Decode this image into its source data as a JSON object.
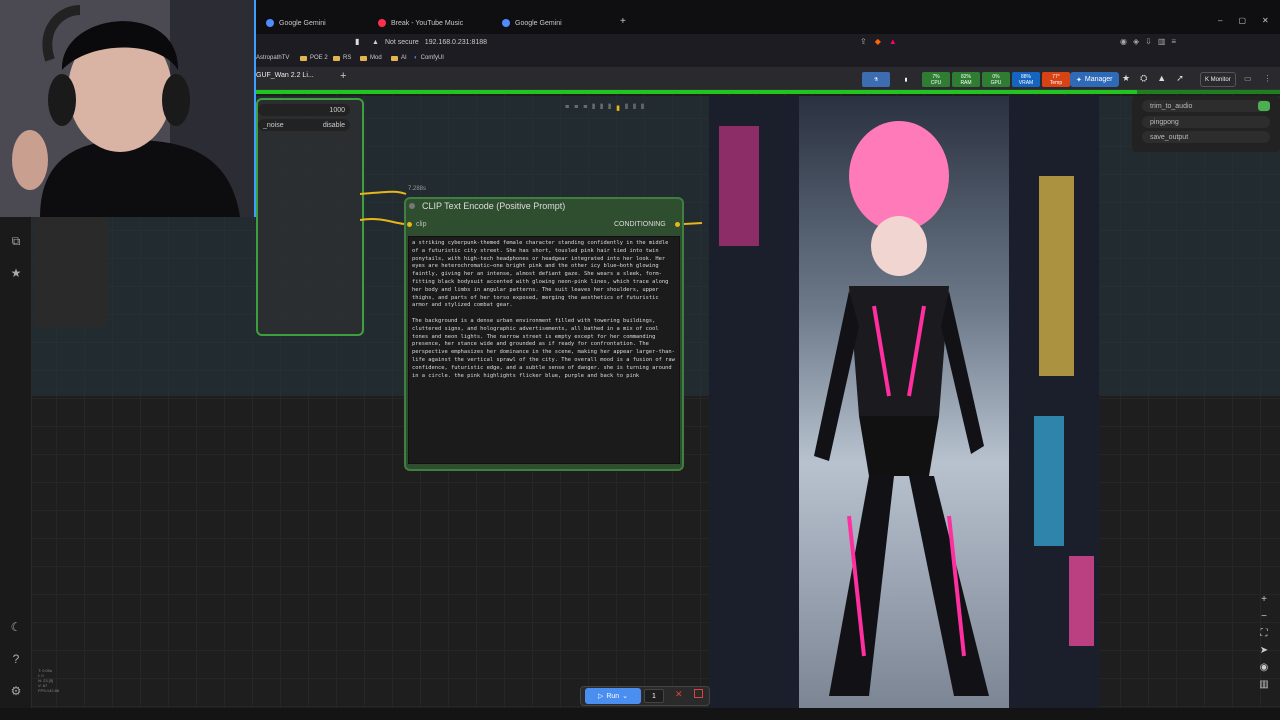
{
  "browser": {
    "tabs": [
      {
        "label": "Google Gemini",
        "color": "#4f8cff"
      },
      {
        "label": "Break - YouTube Music",
        "color": "#ff2e4c"
      },
      {
        "label": "Google Gemini",
        "color": "#4f8cff"
      }
    ],
    "new_tab": "+",
    "security": "Not secure",
    "url": "192.168.0.231:8188",
    "bookmarks": [
      "AstropathTV",
      "POE 2",
      "RS",
      "Mod",
      "AI",
      "ComfyUI"
    ]
  },
  "comfy": {
    "workflow_tab": "GUF_Wan 2.2 Li...",
    "add_tab": "+",
    "monitor": [
      {
        "label": "CPU",
        "value": "7%",
        "color": "#2e7d32"
      },
      {
        "label": "RAM",
        "value": "82%",
        "color": "#2e7d32"
      },
      {
        "label": "GPU",
        "value": "0%",
        "color": "#2e7d32"
      },
      {
        "label": "VRAM",
        "value": "88%",
        "color": "#1565c0"
      },
      {
        "label": "Temp",
        "value": "77°",
        "color": "#d84315"
      }
    ],
    "manager_label": "Manager",
    "kmonitor_label": "K Monitor",
    "progress_fraction": 0.86
  },
  "sampler_node": {
    "widgets": [
      {
        "name": "",
        "value": "1000"
      },
      {
        "name": "_noise",
        "value": "disable"
      }
    ]
  },
  "clip_node": {
    "time": "7.288s",
    "title": "CLIP Text Encode (Positive Prompt)",
    "input": "clip",
    "output": "CONDITIONING",
    "text": "a striking cyberpunk-themed female character standing confidently in the middle of a futuristic city street. She has short, tousled pink hair tied into twin ponytails, with high-tech headphones or headgear integrated into her look. Her eyes are heterochromatic—one bright pink and the other icy blue—both glowing faintly, giving her an intense, almost defiant gaze. She wears a sleek, form-fitting black bodysuit accented with glowing neon-pink lines, which trace along her body and limbs in angular patterns. The suit leaves her shoulders, upper thighs, and parts of her torso exposed, merging the aesthetics of futuristic armor and stylized combat gear.\n\nThe background is a dense urban environment filled with towering buildings, cluttered signs, and holographic advertisements, all bathed in a mix of cool tones and neon lights. The narrow street is empty except for her commanding presence, her stance wide and grounded as if ready for confrontation. The perspective emphasizes her dominance in the scene, making her appear larger-than-life against the vertical sprawl of the city. The overall mood is a fusion of raw confidence, futuristic edge, and a subtle sense of danger. she is turning around in a circle. the pink highlights flicker blue, purple and back to pink"
  },
  "right_panel": {
    "items": [
      "trim_to_audio",
      "pingpong",
      "save_output"
    ]
  },
  "run_bar": {
    "run_label": "Run",
    "batch_count": "1"
  },
  "fps_info": "T: 0.00s\nI: 0\nN: 23 [5]\nV: 67\nFPS:142.86",
  "icons": {
    "left_sidebar": [
      "nodes-map-icon",
      "star-icon",
      "moon-icon",
      "help-icon",
      "settings-icon"
    ],
    "zoom_controls": [
      "zoom-in-icon",
      "zoom-out-icon",
      "fit-view-icon",
      "navigate-icon",
      "eye-icon",
      "map-icon"
    ]
  }
}
